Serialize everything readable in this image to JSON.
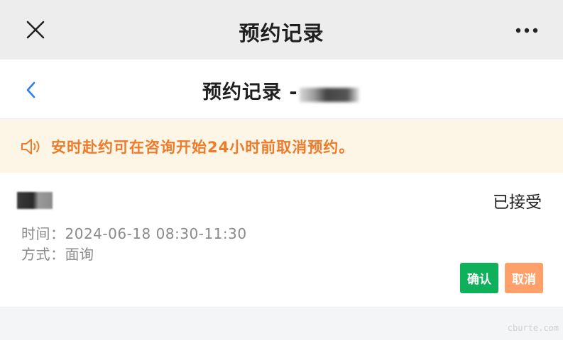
{
  "topbar": {
    "title": "预约记录",
    "close_icon": "close-icon",
    "more_icon": "more-icon"
  },
  "navbar": {
    "title": "预约记录 -",
    "back_icon": "back-icon"
  },
  "notice": {
    "text": "安时赴约可在咨询开始24小时前取消预约。",
    "icon": "speaker-icon",
    "color": "#ee7a2a"
  },
  "record": {
    "status": "已接受",
    "time_label": "时间：",
    "time_value": "2024-06-18 08:30-11:30",
    "mode_label": "方式：",
    "mode_value": "面询",
    "confirm_label": "确认",
    "cancel_label": "取消",
    "confirm_color": "#0fb05a",
    "cancel_color": "#ff9f6a"
  },
  "watermark": "cburte.com"
}
